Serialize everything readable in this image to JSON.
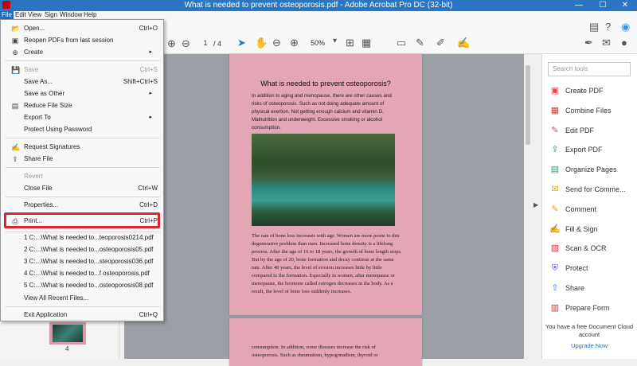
{
  "window": {
    "title": "What is needed to prevent osteoporosis.pdf - Adobe Acrobat Pro DC (32-bit)",
    "minimize": "—",
    "maximize": "☐",
    "close": "✕"
  },
  "menubar": [
    "File",
    "Edit",
    "View",
    "Sign",
    "Window",
    "Help"
  ],
  "toolbar": {
    "page_current": "1",
    "page_total": "/ 4",
    "zoom": "50%"
  },
  "file_menu": {
    "open": {
      "label": "Open...",
      "shortcut": "Ctrl+O"
    },
    "reopen": {
      "label": "Reopen PDFs from last session"
    },
    "create": {
      "label": "Create"
    },
    "save": {
      "label": "Save",
      "shortcut": "Ctrl+S"
    },
    "save_as": {
      "label": "Save As...",
      "shortcut": "Shift+Ctrl+S"
    },
    "save_as_other": {
      "label": "Save as Other"
    },
    "reduce": {
      "label": "Reduce File Size"
    },
    "export_to": {
      "label": "Export To"
    },
    "protect_pw": {
      "label": "Protect Using Password"
    },
    "request_sig": {
      "label": "Request Signatures"
    },
    "share_file": {
      "label": "Share File"
    },
    "revert": {
      "label": "Revert"
    },
    "close": {
      "label": "Close File",
      "shortcut": "Ctrl+W"
    },
    "properties": {
      "label": "Properties...",
      "shortcut": "Ctrl+D"
    },
    "print": {
      "label": "Print...",
      "shortcut": "Ctrl+P"
    },
    "recent": [
      "1 C:...\\What is needed to...teoporosis0214.pdf",
      "2 C:...\\What is needed to...osteoporosis05.pdf",
      "3 C:...\\What is needed to...steoporosis036.pdf",
      "4 C:...\\What is needed to...f osteoporosis.pdf",
      "5 C:...\\What is needed to...osteoporosis08.pdf"
    ],
    "view_all_recent": {
      "label": "View All Recent Files..."
    },
    "exit": {
      "label": "Exit Application",
      "shortcut": "Ctrl+Q"
    }
  },
  "document": {
    "title": "What is needed to prevent osteoporosis?",
    "para1": "In addition to aging and menopause, there are other causes and risks of osteoporosis. Such as not doing adequate amount of physical exertion. Not getting enough calcium and vitamin D. Malnutrition and underweight. Excessive smoking or alcohol consumption.",
    "para2": "The rate of bone loss increases with age. Women are more prone to this degenerative problem than men. Increased bone density is a lifelong process. After the age of 16 to 18 years, the growth of bone length stops. But by the age of 20, bone formation and decay continue at the same rate. After 40 years, the level of erosion increases little by little compared to the formation. Especially in women, after menopause or menopause, the hormone called estrogen decreases in the body. As a result, the level of bone loss suddenly increases.",
    "page2_text": "consumption. In addition, some diseases increase the risk of osteoporosis. Such as rheumatism, hypogonadism, thyroid or"
  },
  "thumbnail_label": "4",
  "right_pane": {
    "search_placeholder": "Search tools",
    "tools": [
      {
        "label": "Create PDF",
        "color": "#e0474c",
        "icon": "create-pdf-icon"
      },
      {
        "label": "Combine Files",
        "color": "#d7373f",
        "icon": "combine-files-icon"
      },
      {
        "label": "Edit PDF",
        "color": "#e34850",
        "icon": "edit-pdf-icon"
      },
      {
        "label": "Export PDF",
        "color": "#2d9d78",
        "icon": "export-pdf-icon"
      },
      {
        "label": "Organize Pages",
        "color": "#2d9d78",
        "icon": "organize-pages-icon"
      },
      {
        "label": "Send for Comme...",
        "color": "#e6a817",
        "icon": "send-for-comment-icon"
      },
      {
        "label": "Comment",
        "color": "#e6a817",
        "icon": "comment-icon"
      },
      {
        "label": "Fill & Sign",
        "color": "#8a4fbf",
        "icon": "fill-sign-icon"
      },
      {
        "label": "Scan & OCR",
        "color": "#d7373f",
        "icon": "scan-ocr-icon"
      },
      {
        "label": "Protect",
        "color": "#5b5bd6",
        "icon": "protect-icon"
      },
      {
        "label": "Share",
        "color": "#2680eb",
        "icon": "share-icon"
      },
      {
        "label": "Prepare Form",
        "color": "#d7373f",
        "icon": "prepare-form-icon"
      }
    ],
    "promo": "You have a free Document Cloud account",
    "upgrade": "Upgrade Now"
  }
}
